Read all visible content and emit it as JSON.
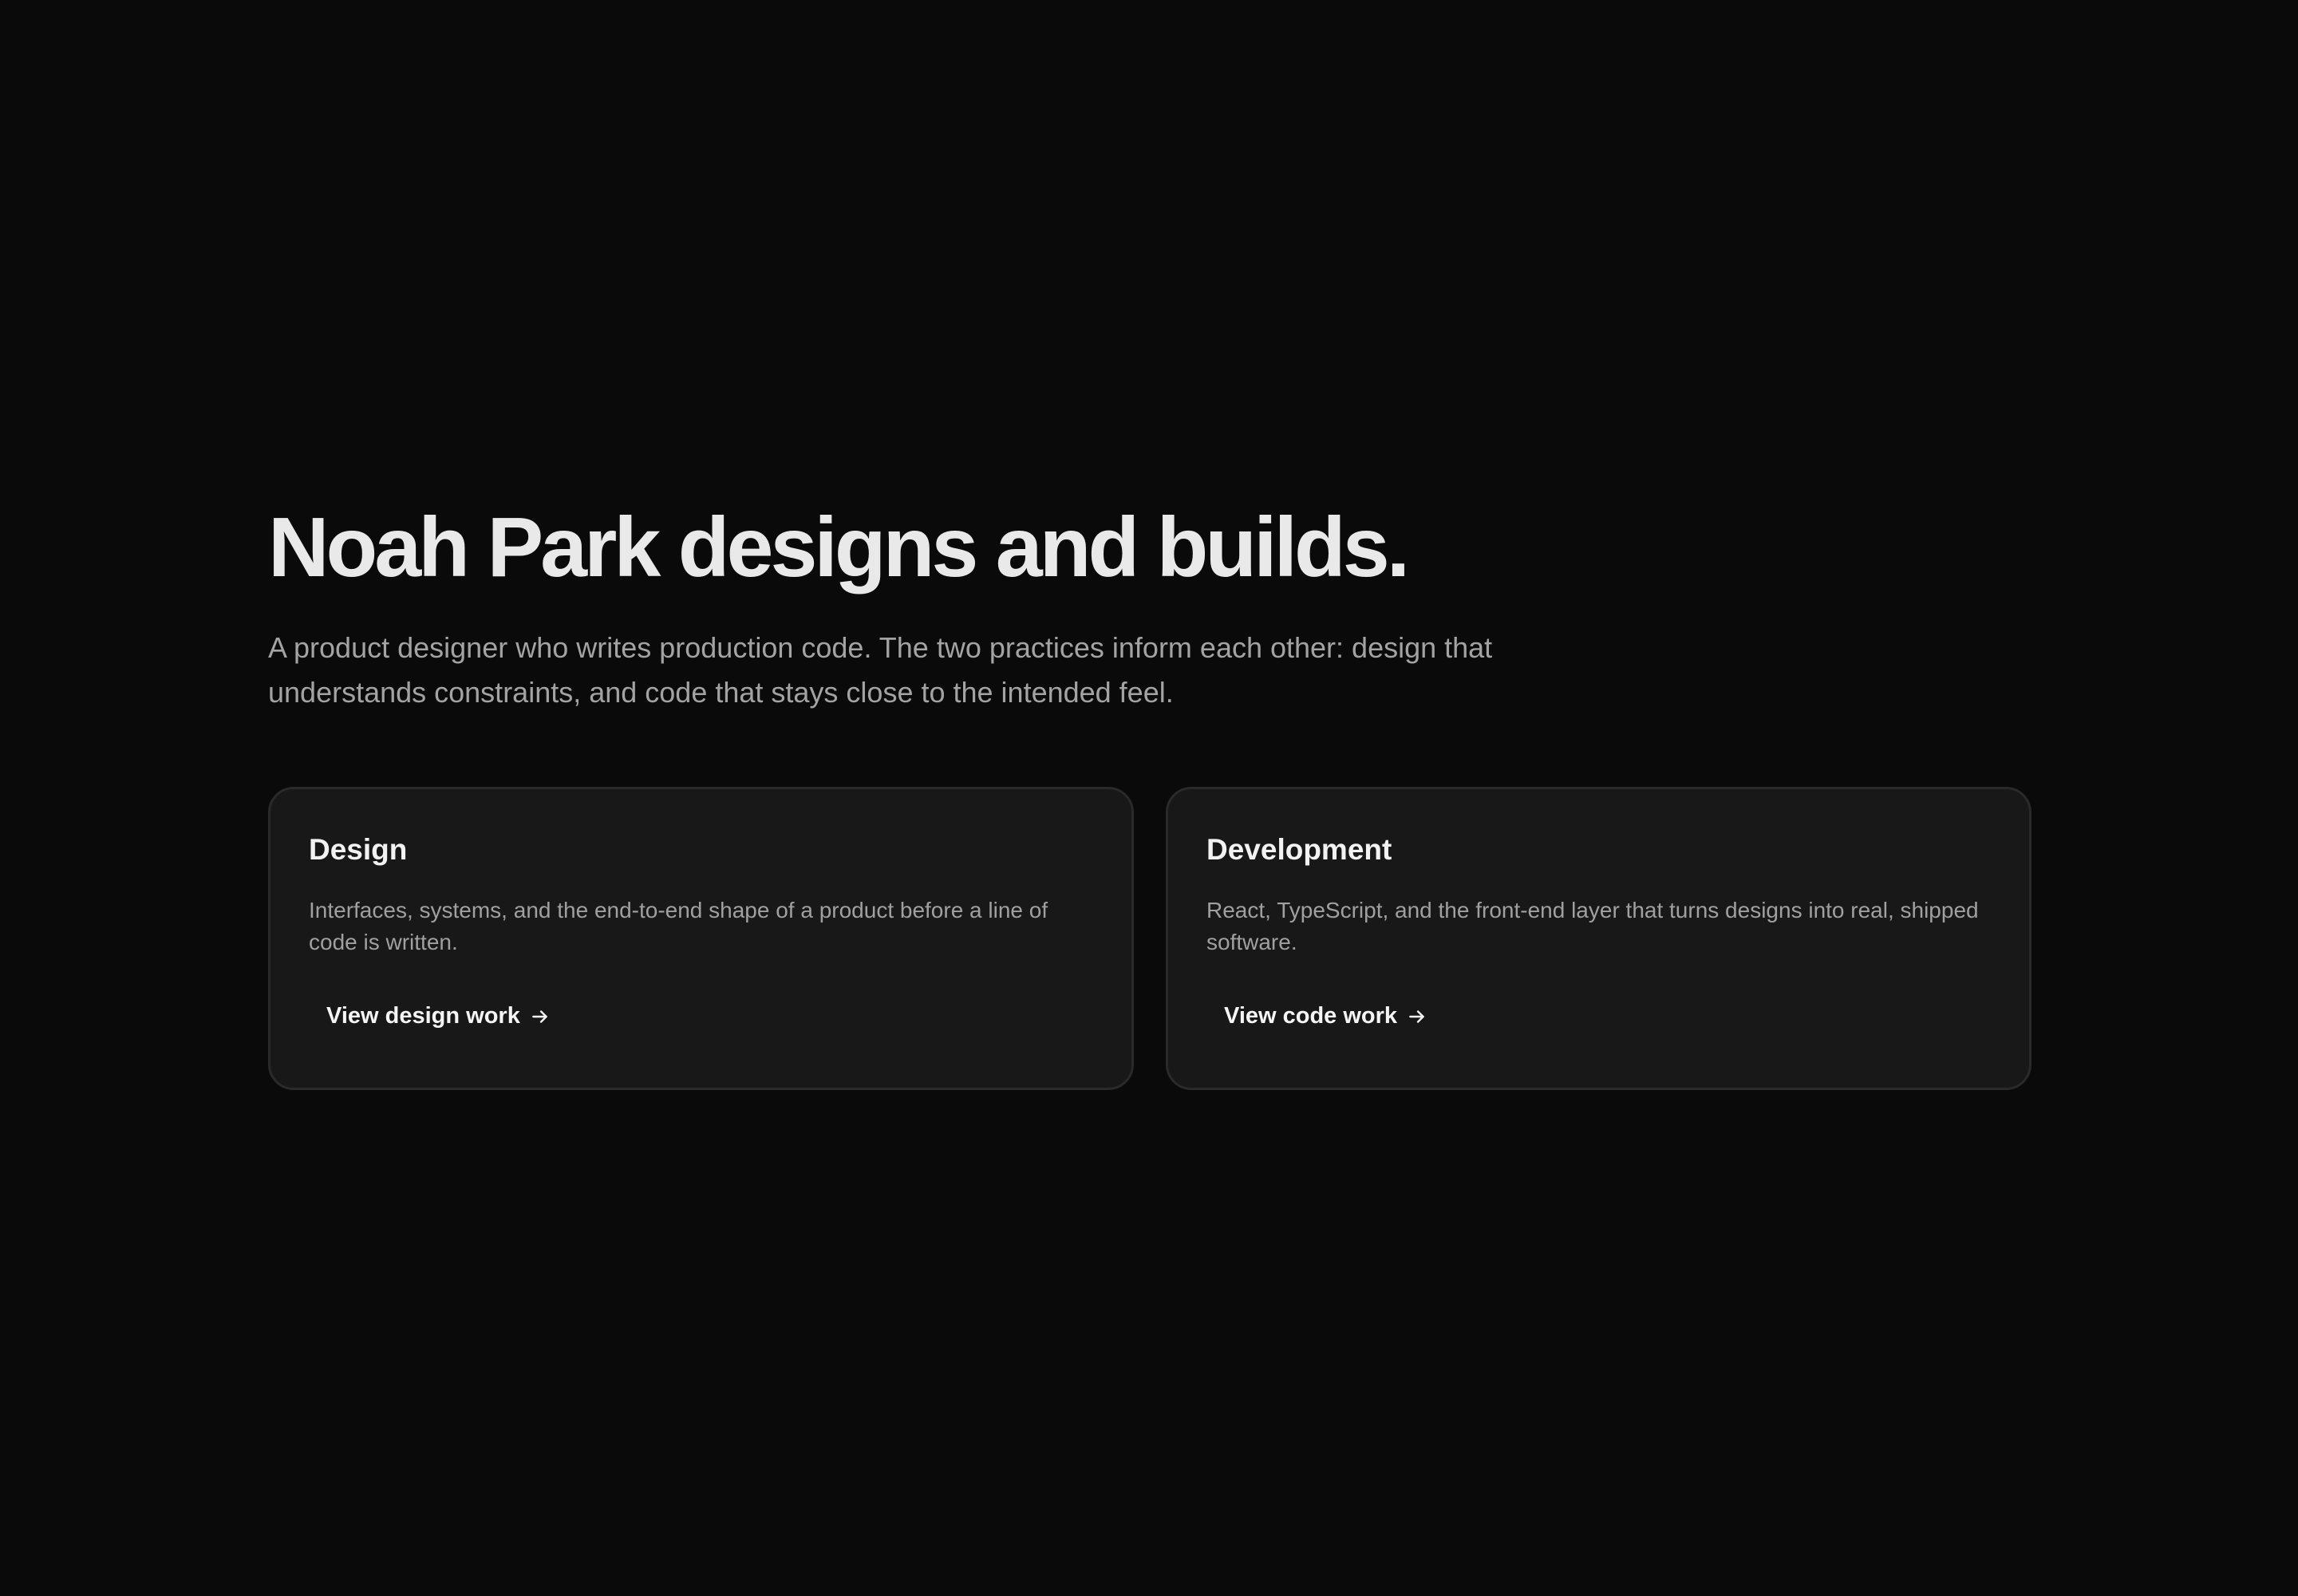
{
  "hero": {
    "title": "Noah Park designs and builds.",
    "subtitle": "A product designer who writes production code. The two practices inform each other: design that understands constraints, and code that stays close to the intended feel."
  },
  "cards": [
    {
      "title": "Design",
      "description": "Interfaces, systems, and the end-to-end shape of a product before a line of code is written.",
      "link_label": "View design work",
      "link_icon": "arrow-right-icon"
    },
    {
      "title": "Development",
      "description": "React, TypeScript, and the front-end layer that turns designs into real, shipped software.",
      "link_label": "View code work",
      "link_icon": "arrow-right-icon"
    }
  ],
  "colors": {
    "background": "#0a0a0a",
    "card_background": "#181818",
    "card_border": "#2a2a2a",
    "title": "#e9e9e9",
    "muted_text": "#a3a3a3"
  }
}
